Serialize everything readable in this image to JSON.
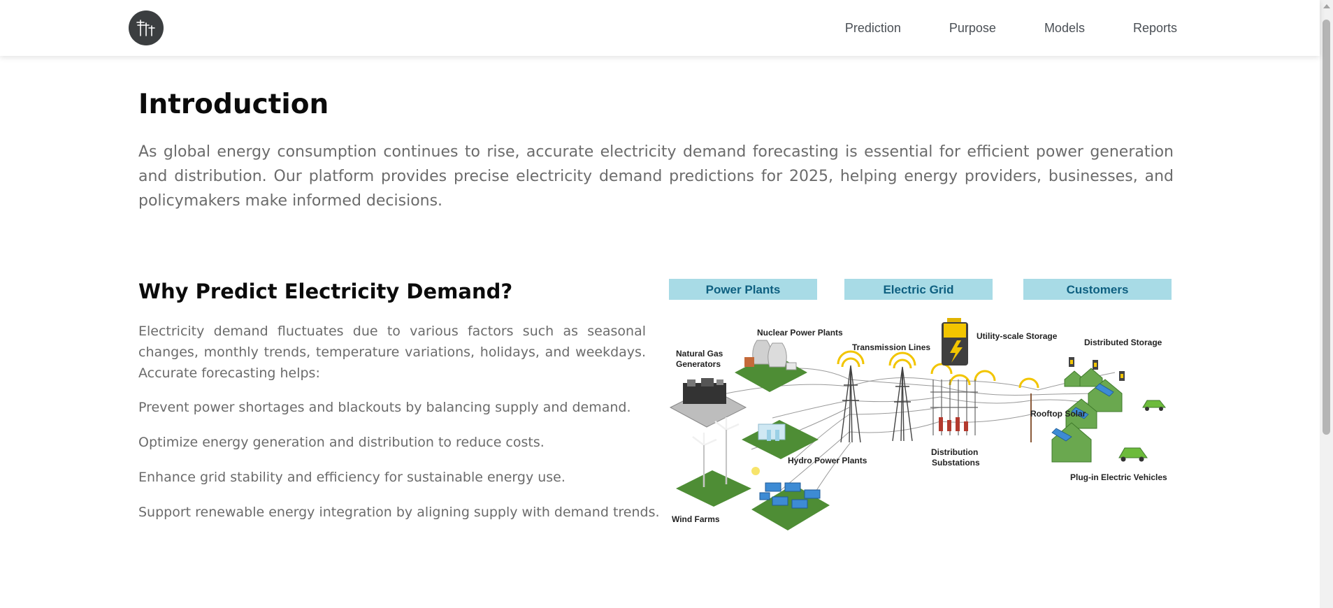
{
  "nav": {
    "logo_icon": "power-line-icon",
    "links": [
      "Prediction",
      "Purpose",
      "Models",
      "Reports"
    ]
  },
  "intro": {
    "title": "Introduction",
    "text": "As global energy consumption continues to rise, accurate electricity demand forecasting is essential for efficient power generation and distribution. Our platform provides precise electricity demand predictions for 2025, helping energy providers, businesses, and policymakers make informed decisions."
  },
  "why": {
    "title": "Why Predict Electricity Demand?",
    "text": "Electricity demand fluctuates due to various factors such as seasonal changes, monthly trends, temperature variations, holidays, and weekdays. Accurate forecasting helps:",
    "benefits": [
      "Prevent power shortages and blackouts by balancing supply and demand.",
      "Optimize energy generation and distribution to reduce costs.",
      "Enhance grid stability and efficiency for sustainable energy use.",
      "Support renewable energy integration by aligning supply with demand trends."
    ]
  },
  "diagram": {
    "headers": [
      "Power Plants",
      "Electric Grid",
      "Customers"
    ],
    "labels": {
      "natural_gas_1": "Natural Gas",
      "natural_gas_2": "Generators",
      "nuclear": "Nuclear Power Plants",
      "transmission": "Transmission Lines",
      "utility_storage": "Utility-scale Storage",
      "distributed_storage": "Distributed Storage",
      "rooftop_solar": "Rooftop Solar",
      "hydro": "Hydro Power Plants",
      "distribution_1": "Distribution",
      "distribution_2": "Substations",
      "plugin_ev": "Plug-in Electric Vehicles",
      "wind": "Wind Farms"
    },
    "colors": {
      "header_bg": "#a8dbe6",
      "header_text": "#0e5f80",
      "grass": "#4e8d35",
      "house": "#6aa84f",
      "arc": "#f2c500"
    }
  }
}
